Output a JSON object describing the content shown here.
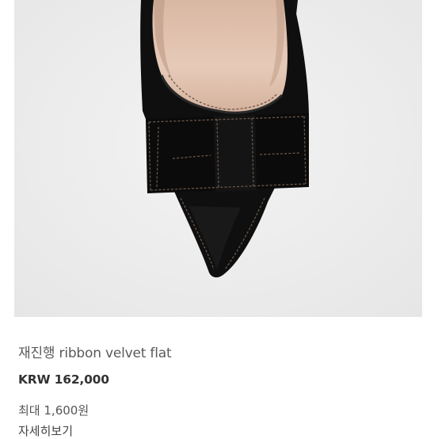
{
  "product": {
    "name": "재진행 ribbon velvet flat",
    "price_currency": "KRW",
    "price_amount": "162,000",
    "points_label": "최대",
    "points_amount": "1,600원",
    "details_link": "자세히보기"
  },
  "image": {
    "subject": "black velvet pointed flat with ribbon, top view",
    "background_color": "#eeeeee",
    "shoe_color": "#0e0e0e",
    "lining_color": "#e4c7b3",
    "stitch_color": "#6a5648"
  }
}
